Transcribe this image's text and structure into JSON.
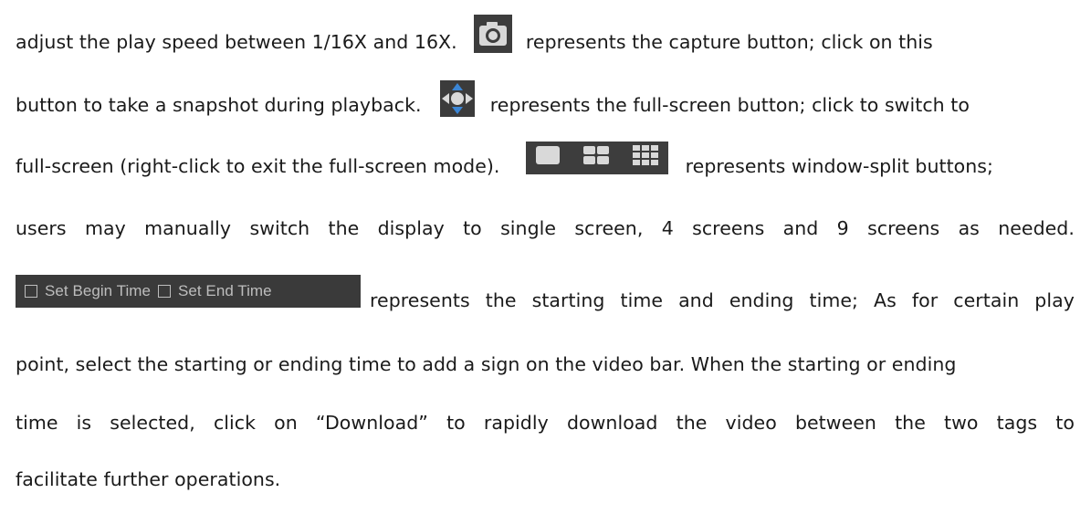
{
  "lines": {
    "l1": {
      "part1": "adjust the play speed between 1/16X and 16X.",
      "part2": "represents the capture button; click on this"
    },
    "l2": {
      "part1": "button to take a snapshot during playback.",
      "part2": "represents the full-screen button; click to switch to"
    },
    "l3": {
      "part1": "full-screen (right-click to exit the full-screen mode).",
      "part2": "represents window-split buttons;"
    },
    "l4": {
      "words": [
        "users",
        "may",
        "manually",
        "switch",
        "the",
        "display",
        "to",
        "single",
        "screen,",
        "4",
        "screens",
        "and",
        "9",
        "screens",
        "as",
        "needed."
      ]
    },
    "l5": {
      "words": [
        "represents",
        "the",
        "starting",
        "time",
        "and",
        "ending",
        "time;",
        "As",
        "for",
        "certain",
        "play"
      ]
    },
    "l6": "point, select the starting or ending time to add a sign on the video bar. When the starting or ending",
    "l7": {
      "words": [
        "time",
        "is",
        "selected,",
        "click",
        "on",
        "“Download”",
        "to",
        "rapidly",
        "download",
        "the",
        "video",
        "between",
        "the",
        "two",
        "tags",
        "to"
      ]
    },
    "l8": "facilitate further operations."
  },
  "controls": {
    "capture_icon": "camera-icon",
    "fullscreen_icon": "four-arrows-icon",
    "split_icons": [
      "single-screen-icon",
      "four-screen-icon",
      "nine-screen-icon"
    ],
    "set_begin_time": "Set Begin Time",
    "set_end_time": "Set End Time"
  },
  "colors": {
    "icon_bg": "#3a3a3a",
    "text": "#1a1a1a",
    "icon_light": "#d9d9d9",
    "accent_blue": "#2f6fb0"
  }
}
